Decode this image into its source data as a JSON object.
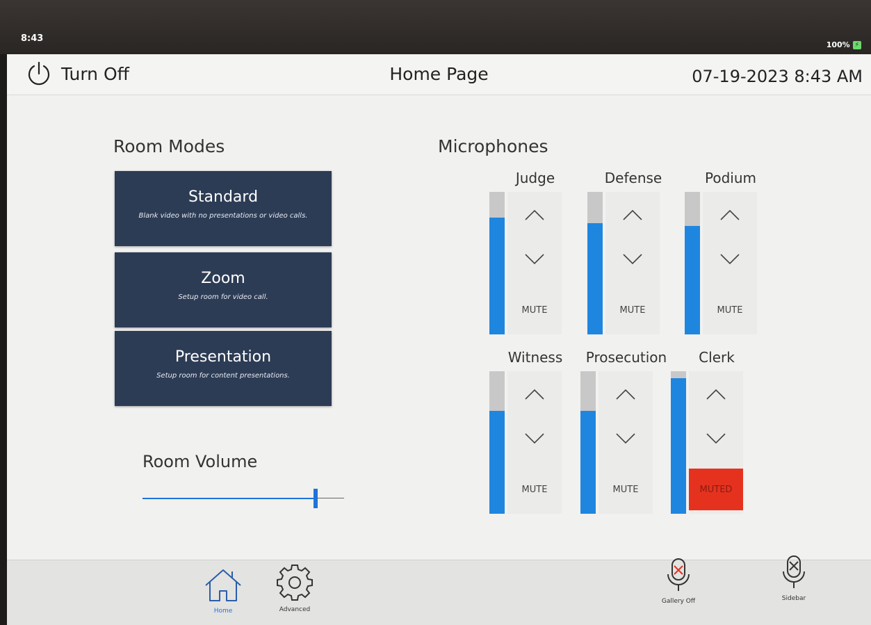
{
  "status_bar": {
    "time": "8:43",
    "battery": "100%"
  },
  "header": {
    "power_label": "Turn Off",
    "title": "Home Page",
    "datetime": "07-19-2023 8:43 AM"
  },
  "room_modes": {
    "label": "Room Modes",
    "modes": [
      {
        "title": "Standard",
        "subtitle": "Blank video with no presentations or video calls.",
        "active": true
      },
      {
        "title": "Zoom",
        "subtitle": "Setup room for video call.",
        "active": false
      },
      {
        "title": "Presentation",
        "subtitle": "Setup room for content presentations.",
        "active": false
      }
    ]
  },
  "room_volume": {
    "label": "Room Volume",
    "level": 0.86
  },
  "microphones": {
    "label": "Microphones",
    "channels": [
      {
        "name": "Judge",
        "level": 0.82,
        "mute_label": "MUTE",
        "muted": false
      },
      {
        "name": "Defense",
        "level": 0.78,
        "mute_label": "MUTE",
        "muted": false
      },
      {
        "name": "Podium",
        "level": 0.76,
        "mute_label": "MUTE",
        "muted": false
      },
      {
        "name": "Witness",
        "level": 0.72,
        "mute_label": "MUTE",
        "muted": false
      },
      {
        "name": "Prosecution",
        "level": 0.72,
        "mute_label": "MUTE",
        "muted": false
      },
      {
        "name": "Clerk",
        "level": 0.95,
        "mute_label": "MUTED",
        "muted": true
      }
    ]
  },
  "footer": {
    "home_label": "Home",
    "advanced_label": "Advanced",
    "gallery_label": "Gallery Off",
    "sidebar_label": "Sidebar"
  },
  "colors": {
    "active_mode": "#0c4ee0",
    "inactive_mode": "#2d3c55",
    "meter": "#1f86e0",
    "muted": "#e5321f"
  }
}
